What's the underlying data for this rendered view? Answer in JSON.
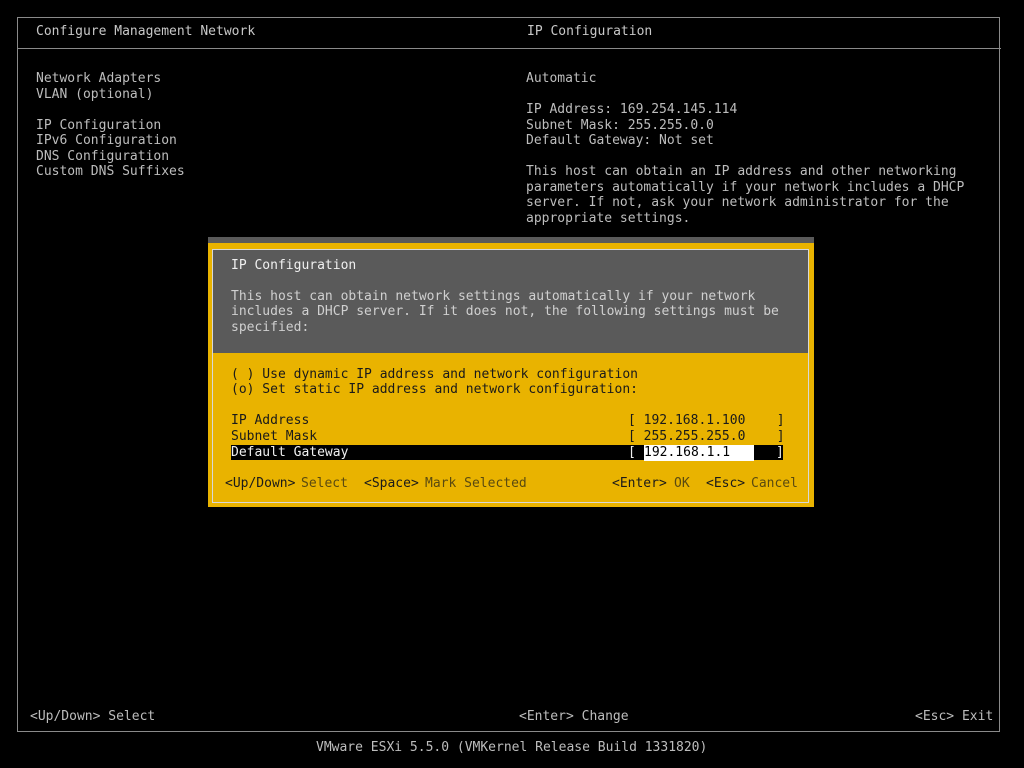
{
  "header": {
    "left_title": "Configure Management Network",
    "right_title": "IP Configuration"
  },
  "menu": {
    "items": [
      "Network Adapters",
      "VLAN (optional)",
      "IP Configuration",
      "IPv6 Configuration",
      "DNS Configuration",
      "Custom DNS Suffixes"
    ]
  },
  "info": {
    "mode": "Automatic",
    "ip_address": "IP Address: 169.254.145.114",
    "subnet_mask": "Subnet Mask: 255.255.0.0",
    "default_gateway": "Default Gateway: Not set",
    "description": [
      "This host can obtain an IP address and other networking",
      "parameters automatically if your network includes a DHCP",
      "server. If not, ask your network administrator for the",
      "appropriate settings."
    ]
  },
  "dialog": {
    "title": "IP Configuration",
    "description": [
      "This host can obtain network settings automatically if your network",
      "includes a DHCP server. If it does not, the following settings must be",
      "specified:"
    ],
    "options": [
      "( ) Use dynamic IP address and network configuration",
      "(o) Set static IP address and network configuration:"
    ],
    "fields": {
      "ip_label": "IP Address",
      "ip_value": "[ 192.168.1.100    ]",
      "mask_label": "Subnet Mask",
      "mask_value": "[ 255.255.255.0    ]",
      "gw_label": "Default Gateway",
      "gw_open": "[ ",
      "gw_value": "192.168.1.1",
      "gw_close": "]"
    },
    "keys": {
      "updown_key": "<Up/Down>",
      "updown_desc": "Select",
      "space_key": "<Space>",
      "space_desc": "Mark Selected",
      "enter_key": "<Enter>",
      "enter_desc": "OK",
      "esc_key": "<Esc>",
      "esc_desc": "Cancel"
    }
  },
  "footer": {
    "left": "<Up/Down> Select",
    "center": "<Enter> Change",
    "right": "<Esc> Exit"
  },
  "version": "VMware ESXi 5.5.0 (VMKernel Release Build 1331820)"
}
